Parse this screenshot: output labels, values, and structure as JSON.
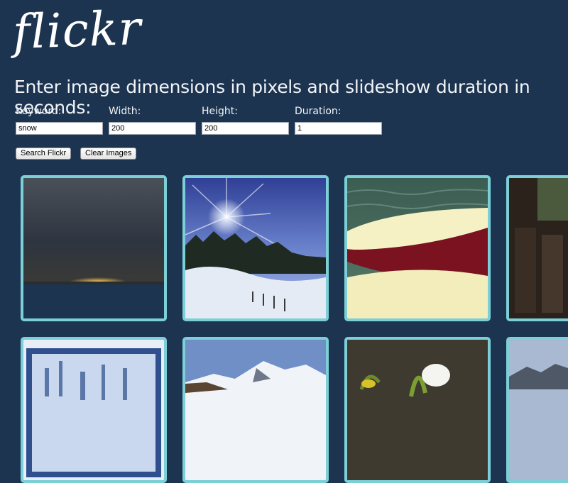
{
  "logo": "flickr",
  "heading": "Enter image dimensions in pixels and slideshow duration in seconds:",
  "fields": [
    {
      "label": "Keyword:",
      "value": "snow"
    },
    {
      "label": "Width:",
      "value": "200"
    },
    {
      "label": "Height:",
      "value": "200"
    },
    {
      "label": "Duration:",
      "value": "1"
    }
  ],
  "buttons": {
    "search": "Search Flickr",
    "clear": "Clear Images"
  },
  "colors": {
    "background": "#1c3450",
    "tile_border": "#7ccfd6"
  }
}
